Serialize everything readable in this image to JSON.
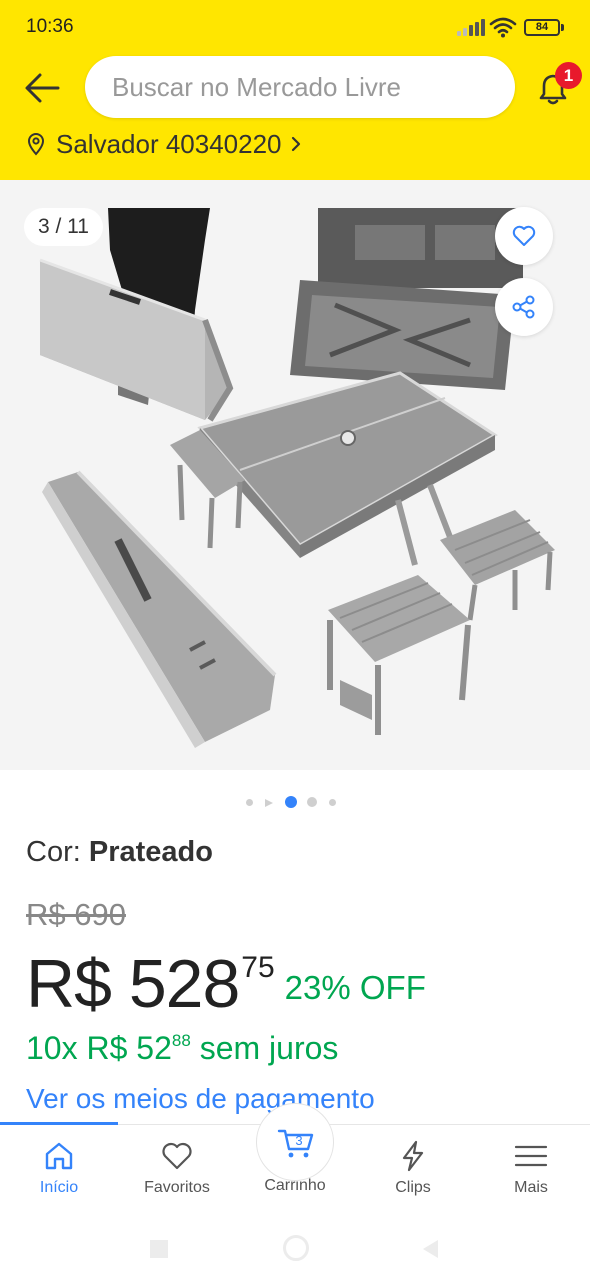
{
  "status_bar": {
    "time": "10:36",
    "battery": "84",
    "icons": [
      "signal-icon",
      "wifi-icon",
      "battery-icon"
    ]
  },
  "header": {
    "back_icon": "arrow-left-icon",
    "search_placeholder": "Buscar no Mercado Livre",
    "notification_icon": "bell-icon",
    "notification_count": "1",
    "location_icon": "pin-icon",
    "location_text": "Salvador 40340220",
    "brand_color": "#FFE600"
  },
  "gallery": {
    "counter": "3 / 11",
    "current_index": 3,
    "total_images": 11,
    "favorite_icon": "heart-icon",
    "share_icon": "share-icon",
    "photo_subject": "folding-aluminum-picnic-table"
  },
  "product": {
    "color_label": "Cor:",
    "color_value": "Prateado",
    "old_price": "R$ 690",
    "price_main": "R$ 528",
    "price_cents": "75",
    "discount": "23% OFF",
    "installments_main": "10x R$ 52",
    "installments_cents": "88",
    "installments_suffix": "sem juros",
    "payment_link": "Ver os meios de pagamento",
    "accent_green": "#00a650",
    "accent_blue": "#3483fa"
  },
  "bottom_nav": {
    "items": [
      {
        "label": "Início",
        "icon": "home-icon",
        "active": true
      },
      {
        "label": "Favoritos",
        "icon": "heart-icon",
        "active": false
      },
      {
        "label": "Carrinho",
        "icon": "cart-icon",
        "active": false,
        "badge": "3"
      },
      {
        "label": "Clips",
        "icon": "lightning-icon",
        "active": false
      },
      {
        "label": "Mais",
        "icon": "menu-icon",
        "active": false
      }
    ]
  },
  "system_nav": {
    "icons": [
      "recents-icon",
      "home-circle-icon",
      "back-triangle-icon"
    ]
  }
}
